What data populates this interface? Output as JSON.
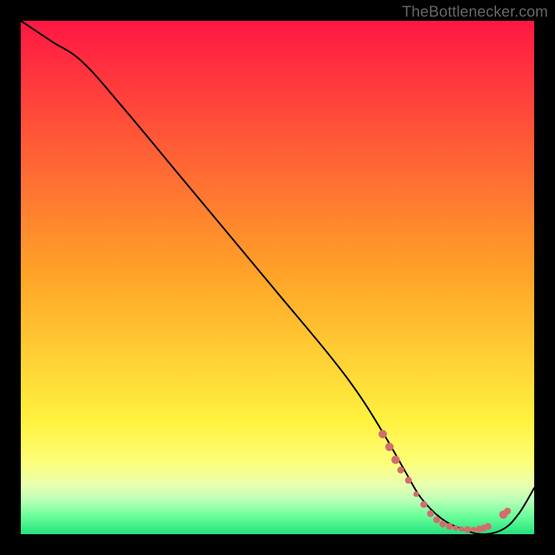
{
  "watermark": "TheBottlenecker.com",
  "chart_data": {
    "type": "line",
    "title": "",
    "xlabel": "",
    "ylabel": "",
    "xlim": [
      0,
      100
    ],
    "ylim": [
      0,
      100
    ],
    "background_gradient": {
      "stops": [
        {
          "offset": 0.0,
          "color": "#ff1744"
        },
        {
          "offset": 0.5,
          "color": "#ffa528"
        },
        {
          "offset": 0.78,
          "color": "#fff23f"
        },
        {
          "offset": 0.86,
          "color": "#feff7a"
        },
        {
          "offset": 0.905,
          "color": "#e8ffb0"
        },
        {
          "offset": 0.935,
          "color": "#b7ffb7"
        },
        {
          "offset": 0.965,
          "color": "#6aff9a"
        },
        {
          "offset": 1.0,
          "color": "#25e07e"
        }
      ]
    },
    "series": [
      {
        "name": "curve",
        "x": [
          0,
          6,
          12,
          20,
          30,
          40,
          50,
          60,
          66,
          71,
          75,
          78,
          82,
          86,
          90,
          94,
          97,
          100
        ],
        "y": [
          100,
          96,
          92,
          83,
          71,
          59,
          47,
          35,
          27,
          19,
          12,
          7,
          3,
          1,
          0,
          1,
          4,
          9
        ]
      }
    ],
    "markers": {
      "comment": "scatter dots near the trough of the curve",
      "color": "#d26d6d",
      "radius_seq": [
        6,
        6,
        6,
        5,
        5,
        4,
        5,
        5,
        5,
        5,
        5,
        4,
        4,
        5,
        4,
        5,
        5,
        5,
        6,
        5
      ],
      "x": [
        70.5,
        71.8,
        73.0,
        74.0,
        75.5,
        77.0,
        78.5,
        79.8,
        81.0,
        82.2,
        83.5,
        84.7,
        85.8,
        87.0,
        88.2,
        89.3,
        90.2,
        91.0,
        94.0,
        94.8
      ],
      "y": [
        19.5,
        17.0,
        14.5,
        12.5,
        10.5,
        7.8,
        5.8,
        4.0,
        2.8,
        2.0,
        1.5,
        1.2,
        1.0,
        0.9,
        0.9,
        1.0,
        1.2,
        1.5,
        3.8,
        4.5
      ]
    }
  }
}
